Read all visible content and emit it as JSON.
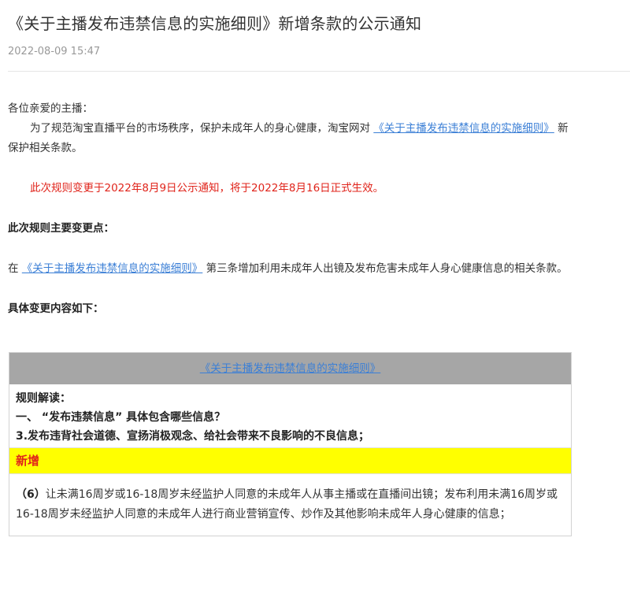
{
  "article": {
    "title": "《关于主播发布违禁信息的实施细则》新增条款的公示通知",
    "date": "2022-08-09 15:47"
  },
  "content": {
    "greeting": "各位亲爱的主播：",
    "intro_pre": "为了规范淘宝直播平台的市场秩序，保护未成年人的身心健康，淘宝网对 ",
    "intro_link": "《关于主播发布违禁信息的实施细则》",
    "intro_post": " 新",
    "intro_line2": "保护相关条款。",
    "notice": "此次规则变更于2022年8月9日公示通知，将于2022年8月16日正式生效。",
    "changes_heading": "此次规则主要变更点：",
    "change_pre": "在 ",
    "change_link": "《关于主播发布违禁信息的实施细则》",
    "change_post": " 第三条增加利用未成年人出镜及发布危害未成年人身心健康信息的相关条款。",
    "details_heading": "具体变更内容如下："
  },
  "table": {
    "header_link": "《关于主播发布违禁信息的实施细则》",
    "section_lines": [
      "规则解读：",
      "一、 “发布违禁信息” 具体包含哪些信息？",
      "3.发布违背社会道德、宣扬消极观念、给社会带来不良影响的不良信息；"
    ],
    "new_label": "新增",
    "item_number": "（6）",
    "item_text": "让未满16周岁或16-18周岁未经监护人同意的未成年人从事主播或在直播间出镜；发布利用未满16周岁或16-18周岁未经监护人同意的未成年人进行商业营销宣传、炒作及其他影响未成年人身心健康的信息；"
  }
}
